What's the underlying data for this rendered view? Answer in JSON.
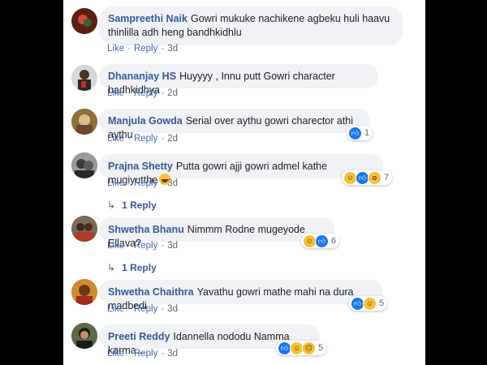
{
  "comments": [
    {
      "name": "Sampreethi Naik",
      "text": "Gowri mukuke nachikene agbeku huli haavu thinlilla adh heng bandhkidhlu",
      "like": "Like",
      "reply": "Reply",
      "time": "3d",
      "avatar_color": "#7a2d1e"
    },
    {
      "name": "Dhananjay HS",
      "text": "Huyyyy , Innu putt Gowri character badhkidhya",
      "like": "Like",
      "reply": "Reply",
      "time": "2d",
      "avatar_color": "#3b2a20"
    },
    {
      "name": "Manjula Gowda",
      "text": "Serial over aythu gowri charector athi aythu",
      "like": "Like",
      "reply": "Reply",
      "time": "2d",
      "reactions": [
        "like-icon"
      ],
      "reaction_count": "1",
      "avatar_color": "#b89a5a"
    },
    {
      "name": "Prajna Shetty",
      "text": "Putta gowri ajji gowri admel kathe mugiyutthe",
      "like": "Like",
      "reply": "Reply",
      "time": "3d",
      "reactions": [
        "haha-icon",
        "like-icon",
        "wow-icon"
      ],
      "reaction_count": "7",
      "replies_label": "1 Reply",
      "avatar_color": "#6a6a6a"
    },
    {
      "name": "Shwetha Bhanu",
      "text": "Nimmm Rodne mugeyode Ellava?",
      "like": "Like",
      "reply": "Reply",
      "time": "3d",
      "reactions": [
        "haha-icon",
        "like-icon"
      ],
      "reaction_count": "6",
      "replies_label": "1 Reply",
      "avatar_color": "#8a5a3a"
    },
    {
      "name": "Shwetha Chaithra",
      "text": "Yavathu gowri mathe mahi na dura madbedi",
      "like": "Like",
      "reply": "Reply",
      "time": "3d",
      "reactions": [
        "like-icon",
        "haha-icon"
      ],
      "reaction_count": "5",
      "avatar_color": "#c0772a"
    },
    {
      "name": "Preeti Reddy",
      "text": "Idannella nododu Namma karma...",
      "like": "Like",
      "reply": "Reply",
      "time": "3d",
      "reactions": [
        "like-icon",
        "haha-icon",
        "sad-icon"
      ],
      "reaction_count": "5",
      "avatar_color": "#4a5a3a"
    }
  ]
}
